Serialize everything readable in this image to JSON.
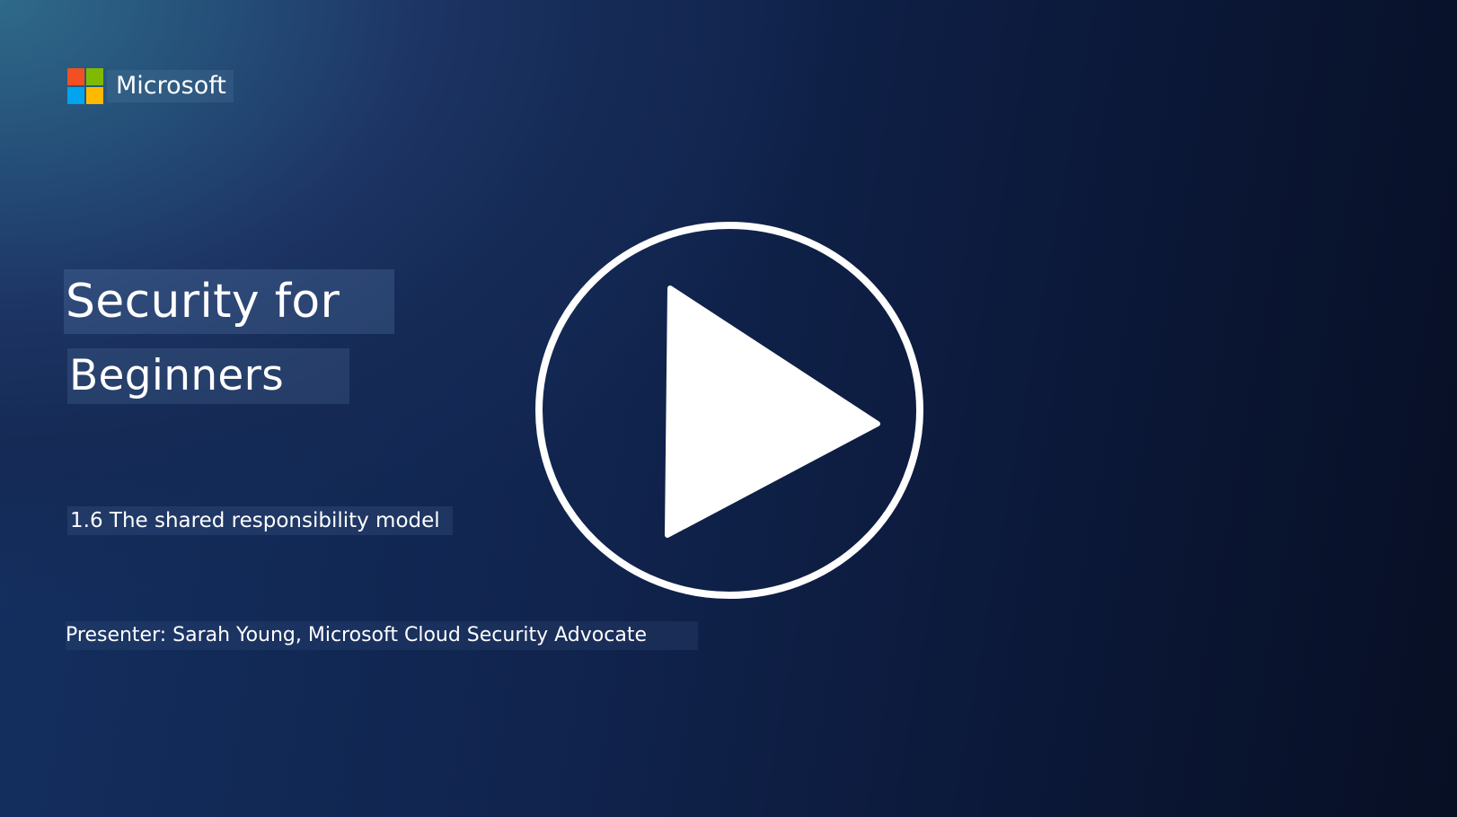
{
  "brand": {
    "name": "Microsoft",
    "logo_colors": [
      "#f25022",
      "#7fba00",
      "#00a4ef",
      "#ffb900"
    ]
  },
  "video": {
    "title_line_1": "Security for",
    "title_line_2": "Beginners",
    "lesson": "1.6 The shared responsibility model",
    "presenter": "Presenter: Sarah Young, Microsoft Cloud Security Advocate",
    "play_icon": "play-icon"
  },
  "colors": {
    "text": "#ffffff",
    "background_dark": "#0a1530",
    "background_light": "#2f6a8a"
  }
}
